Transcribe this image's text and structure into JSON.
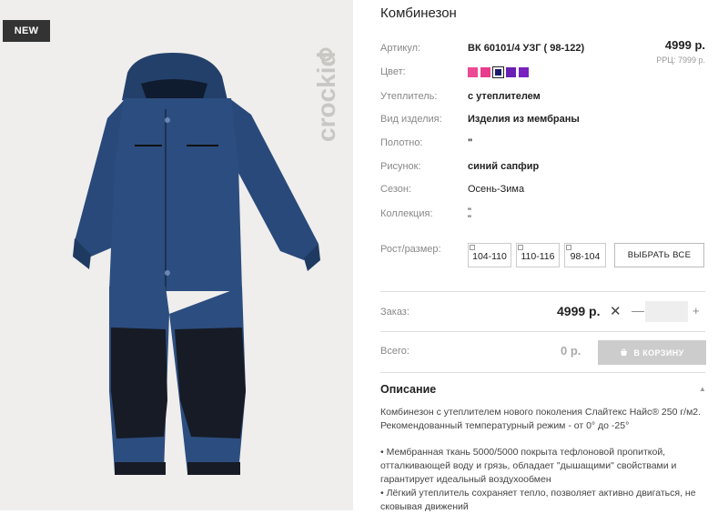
{
  "product": {
    "badge": "NEW",
    "brand": "crockid",
    "title": "Комбинезон",
    "price": "4999 р.",
    "rrp": "РРЦ: 7999 р."
  },
  "attributes": [
    {
      "label": "Артикул:",
      "value": "ВК 60101/4 УЗГ ( 98-122)"
    },
    {
      "label": "Цвет:",
      "value": ""
    },
    {
      "label": "Утеплитель:",
      "value": "с утеплителем"
    },
    {
      "label": "Вид изделия:",
      "value": "Изделия из мембраны"
    },
    {
      "label": "Полотно:",
      "value": "\""
    },
    {
      "label": "Рисунок:",
      "value": "синий сапфир"
    },
    {
      "label": "Сезон:",
      "value": "Осень-Зима"
    },
    {
      "label": "Коллекция:",
      "value": "\"",
      "value2": "\""
    },
    {
      "label": "Рост/размер:",
      "value": ""
    }
  ],
  "colors": [
    "#ec4a92",
    "#e83c8c",
    "#1a1a6e",
    "#6a1fb4",
    "#7a22c0"
  ],
  "sizes": [
    "104-110",
    "110-116",
    "98-104"
  ],
  "select_all_label": "ВЫБРАТЬ ВСЕ",
  "order": {
    "label": "Заказ:",
    "price": "4999 р.",
    "times": "✕",
    "minus": "—",
    "plus": "+",
    "qty_value": ""
  },
  "total": {
    "label": "Всего:",
    "value": "0 р.",
    "cart_label": "В КОРЗИНУ"
  },
  "description": {
    "title": "Описание",
    "p1": "Комбинезон с утеплителем нового поколения Слайтекс Найс® 250 г/м2. Рекомендованный температурный режим - от 0° до -25°",
    "p2": "• Мембранная ткань 5000/5000 покрыта тефлоновой пропиткой, отталкивающей воду и грязь, обладает \"дышащими\" свойствами и гарантирует идеальный воздухообмен",
    "p3": "• Лёгкий утеплитель сохраняет тепло, позволяет активно двигаться, не сковывая движений"
  },
  "icons": {
    "cart": "cart-icon",
    "checkbox": "checkbox-icon",
    "collapse": "chevron-up-icon"
  }
}
